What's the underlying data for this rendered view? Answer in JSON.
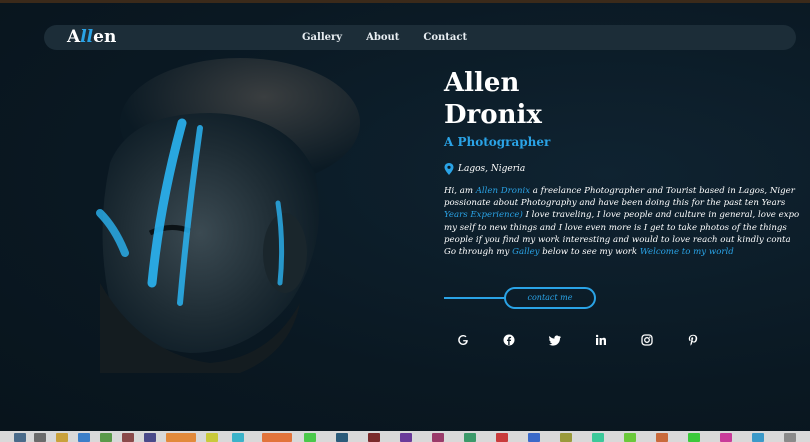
{
  "brand": {
    "logo_prefix": "A",
    "logo_accent": "ll",
    "logo_suffix": "en"
  },
  "nav": {
    "items": [
      {
        "label": "Gallery"
      },
      {
        "label": "About"
      },
      {
        "label": "Contact"
      }
    ]
  },
  "hero": {
    "first_name": "Allen",
    "last_name": "Dronix",
    "tagline": "A Photographer",
    "location": "Lagos, Nigeria",
    "bio_lines": [
      [
        "Hi, am ",
        "Allen Dronix",
        " a freelance Photographer and Tourist based in Lagos, Niger"
      ],
      [
        "possionate about Photography and have been doing this for the past ten Years"
      ],
      [
        "Years Experience)",
        " I love traveling, I love people and culture in general, love expo"
      ],
      [
        "my self to new things and I love even more is I get to take photos of the things"
      ],
      [
        "people if you find my work interesting and would to love reach out kindly conta"
      ],
      [
        "Go through my ",
        "Galley",
        " below to see my work ",
        "Welcome to my world"
      ]
    ],
    "cta_label": "contact me"
  },
  "socials": [
    {
      "icon": "google-icon"
    },
    {
      "icon": "facebook-icon"
    },
    {
      "icon": "twitter-icon"
    },
    {
      "icon": "linkedin-icon"
    },
    {
      "icon": "instagram-icon"
    },
    {
      "icon": "pinterest-icon"
    }
  ],
  "colors": {
    "accent": "#2aa3e6",
    "background": "#0b1a24",
    "navbar": "#1c2d38",
    "text": "#ffffff"
  }
}
